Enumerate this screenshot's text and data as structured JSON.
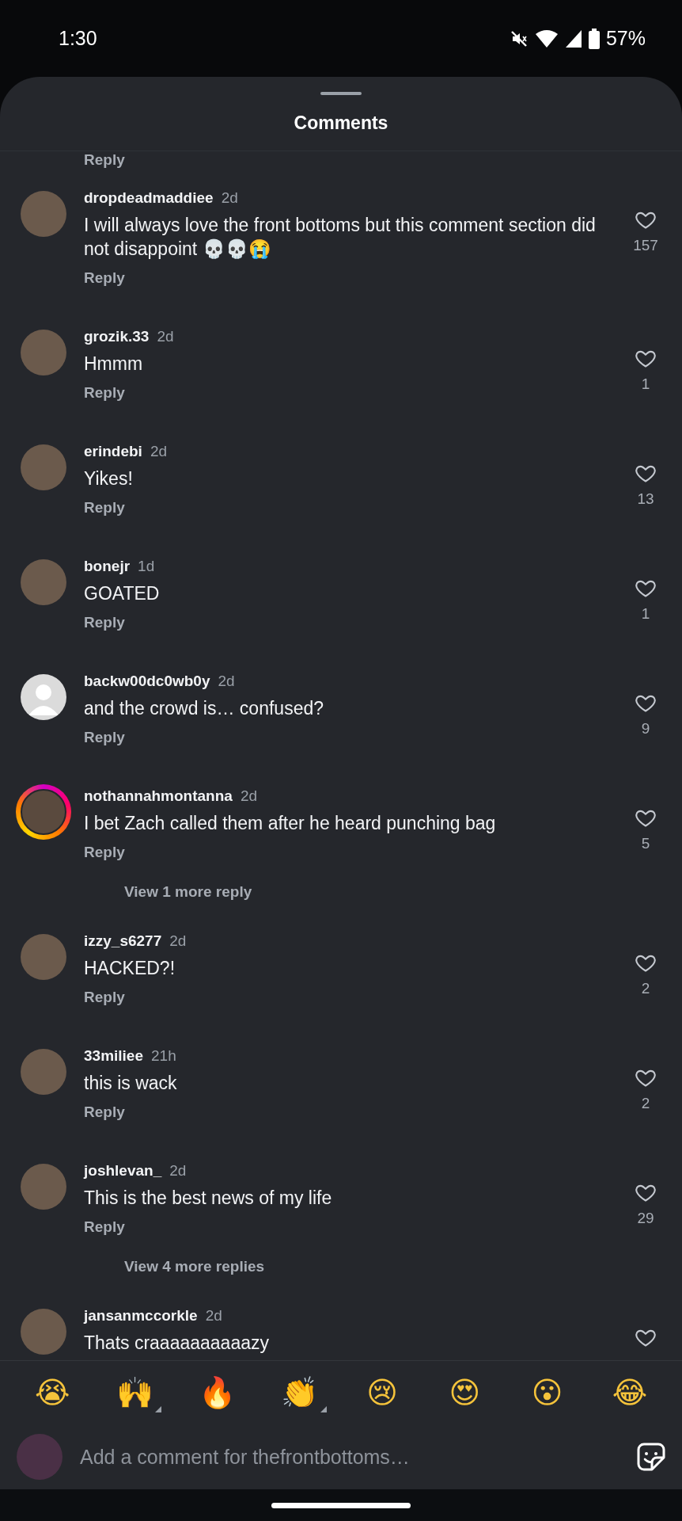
{
  "status_bar": {
    "time": "1:30",
    "battery": "57%"
  },
  "sheet": {
    "title": "Comments",
    "top_reply": "Reply"
  },
  "comments": [
    {
      "username": "dropdeadmaddiee",
      "age": "2d",
      "text": "I will always love the front bottoms but this comment section did not disappoint 💀💀😭",
      "reply": "Reply",
      "likes": "157",
      "liked": false,
      "kind": "photo",
      "story": false
    },
    {
      "username": "grozik.33",
      "age": "2d",
      "text": "Hmmm",
      "reply": "Reply",
      "likes": "1",
      "liked": false,
      "kind": "photo",
      "story": false
    },
    {
      "username": "erindebi",
      "age": "2d",
      "text": "Yikes!",
      "reply": "Reply",
      "likes": "13",
      "liked": false,
      "kind": "photo",
      "story": false
    },
    {
      "username": "bonejr",
      "age": "1d",
      "text": "GOATED",
      "reply": "Reply",
      "likes": "1",
      "liked": false,
      "kind": "photo",
      "story": false
    },
    {
      "username": "backw00dc0wb0y",
      "age": "2d",
      "text": "and the crowd is… confused?",
      "reply": "Reply",
      "likes": "9",
      "liked": false,
      "kind": "default",
      "story": false
    },
    {
      "username": "nothannahmontanna",
      "age": "2d",
      "text": "I bet Zach called them after he heard punching bag",
      "reply": "Reply",
      "likes": "5",
      "liked": false,
      "kind": "photo",
      "story": true,
      "more_replies": "View 1 more reply"
    },
    {
      "username": "izzy_s6277",
      "age": "2d",
      "text": "HACKED?!",
      "reply": "Reply",
      "likes": "2",
      "liked": false,
      "kind": "photo",
      "story": false
    },
    {
      "username": "33miliee",
      "age": "21h",
      "text": "this is wack",
      "reply": "Reply",
      "likes": "2",
      "liked": false,
      "kind": "photo",
      "story": false
    },
    {
      "username": "joshlevan_",
      "age": "2d",
      "text": "This is the best news of my life",
      "reply": "Reply",
      "likes": "29",
      "liked": false,
      "kind": "photo",
      "story": false,
      "more_replies": "View 4 more replies"
    },
    {
      "username": "jansanmccorkle",
      "age": "2d",
      "text": "Thats craaaaaaaaaazy",
      "liked": false,
      "kind": "photo",
      "story": false
    }
  ],
  "reactions": [
    {
      "emoji": "😭",
      "variants": false
    },
    {
      "emoji": "🙌",
      "variants": true
    },
    {
      "emoji": "🔥",
      "variants": false
    },
    {
      "emoji": "👏",
      "variants": true
    },
    {
      "emoji": "😢",
      "variants": false
    },
    {
      "emoji": "😍",
      "variants": false
    },
    {
      "emoji": "😮",
      "variants": false
    },
    {
      "emoji": "😂",
      "variants": false
    }
  ],
  "composer": {
    "placeholder": "Add a comment for thefrontbottoms…"
  }
}
